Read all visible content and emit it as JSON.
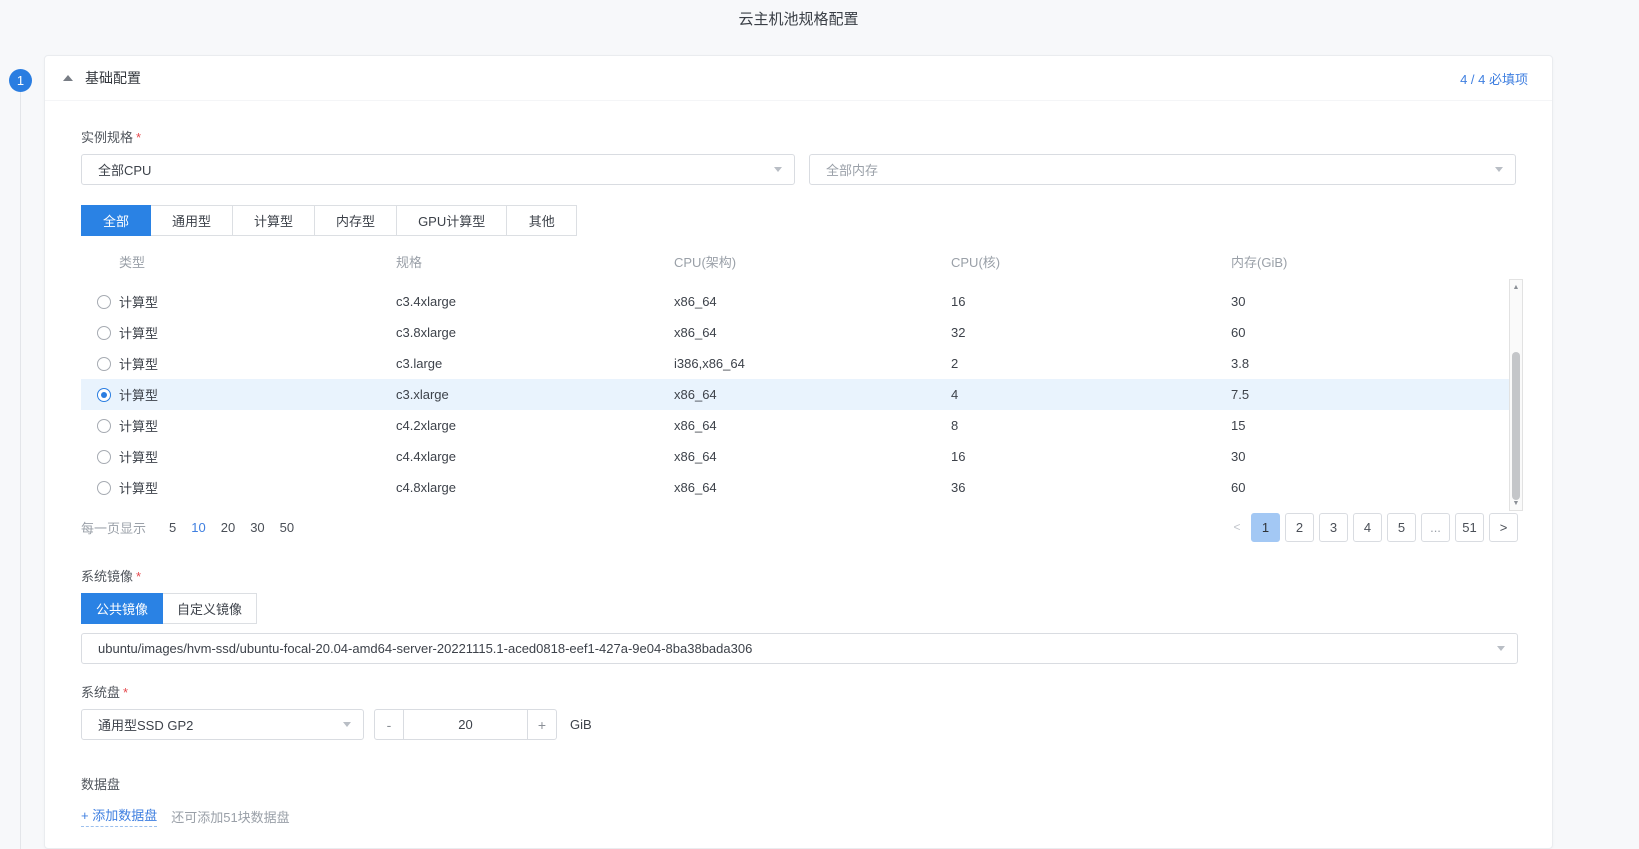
{
  "page": {
    "title": "云主机池规格配置"
  },
  "section": {
    "step_number": "1",
    "title": "基础配置",
    "required_badge": "4 / 4 必填项"
  },
  "instance_spec": {
    "label": "实例规格",
    "required_mark": "*",
    "cpu_select_value": "全部CPU",
    "memory_select_placeholder": "全部内存",
    "tabs": [
      {
        "label": "全部",
        "active": true
      },
      {
        "label": "通用型",
        "active": false
      },
      {
        "label": "计算型",
        "active": false
      },
      {
        "label": "内存型",
        "active": false
      },
      {
        "label": "GPU计算型",
        "active": false
      },
      {
        "label": "其他",
        "active": false
      }
    ],
    "table": {
      "columns": [
        "类型",
        "规格",
        "CPU(架构)",
        "CPU(核)",
        "内存(GiB)"
      ],
      "rows": [
        {
          "type": "计算型",
          "spec": "c3.4xlarge",
          "arch": "x86_64",
          "cpu": "16",
          "mem": "30",
          "selected": false
        },
        {
          "type": "计算型",
          "spec": "c3.8xlarge",
          "arch": "x86_64",
          "cpu": "32",
          "mem": "60",
          "selected": false
        },
        {
          "type": "计算型",
          "spec": "c3.large",
          "arch": "i386,x86_64",
          "cpu": "2",
          "mem": "3.8",
          "selected": false
        },
        {
          "type": "计算型",
          "spec": "c3.xlarge",
          "arch": "x86_64",
          "cpu": "4",
          "mem": "7.5",
          "selected": true
        },
        {
          "type": "计算型",
          "spec": "c4.2xlarge",
          "arch": "x86_64",
          "cpu": "8",
          "mem": "15",
          "selected": false
        },
        {
          "type": "计算型",
          "spec": "c4.4xlarge",
          "arch": "x86_64",
          "cpu": "16",
          "mem": "30",
          "selected": false
        },
        {
          "type": "计算型",
          "spec": "c4.8xlarge",
          "arch": "x86_64",
          "cpu": "36",
          "mem": "60",
          "selected": false
        }
      ]
    },
    "pagination": {
      "page_size_label": "每一页显示",
      "page_sizes": [
        "5",
        "10",
        "20",
        "30",
        "50"
      ],
      "active_page_size": "10",
      "prev": "<",
      "pages": [
        "1",
        "2",
        "3",
        "4",
        "5",
        "...",
        "51"
      ],
      "active_page": "1",
      "next": ">"
    }
  },
  "system_image": {
    "label": "系统镜像",
    "required_mark": "*",
    "tabs": [
      {
        "label": "公共镜像",
        "active": true
      },
      {
        "label": "自定义镜像",
        "active": false
      }
    ],
    "select_value": "ubuntu/images/hvm-ssd/ubuntu-focal-20.04-amd64-server-20221115.1-aced0818-eef1-427a-9e04-8ba38bada306"
  },
  "system_disk": {
    "label": "系统盘",
    "required_mark": "*",
    "type_select_value": "通用型SSD GP2",
    "stepper": {
      "decrease": "-",
      "value": "20",
      "increase": "+"
    },
    "unit": "GiB"
  },
  "data_disk": {
    "label": "数据盘",
    "add_link": "+ 添加数据盘",
    "hint": "还可添加51块数据盘"
  },
  "colors": {
    "accent": "#2a82e4",
    "link_blue": "#3f7fe0",
    "selected_row_bg": "#e9f3fd",
    "active_page_bg": "#a3c8f4",
    "required_red": "#e5484d"
  }
}
